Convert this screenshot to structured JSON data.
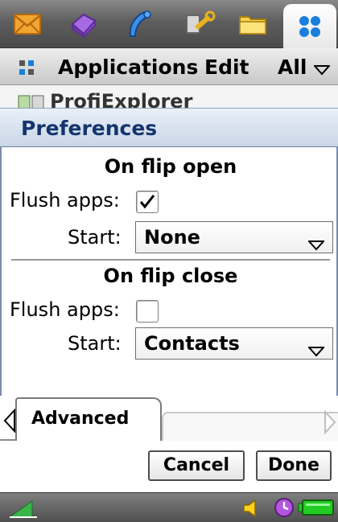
{
  "topbar": {
    "icons": [
      "messaging-icon",
      "web-icon",
      "phone-icon",
      "tools-icon",
      "folder-icon",
      "applications-grid-icon"
    ]
  },
  "menubar": {
    "title": "Applications",
    "edit": "Edit",
    "filter": "All"
  },
  "background_item": "ProfiExplorer",
  "dialog": {
    "title": "Preferences",
    "on_open": {
      "heading": "On flip open",
      "flush_label": "Flush apps:",
      "flush_checked": true,
      "start_label": "Start:",
      "start_value": "None"
    },
    "on_close": {
      "heading": "On flip close",
      "flush_label": "Flush apps:",
      "flush_checked": false,
      "start_label": "Start:",
      "start_value": "Contacts"
    },
    "tabs": [
      "Advanced"
    ],
    "buttons": {
      "cancel": "Cancel",
      "done": "Done"
    }
  },
  "status": {
    "icons": [
      "signal-icon",
      "volume-icon",
      "alarm-icon",
      "battery-icon"
    ]
  },
  "colors": {
    "title_text": "#14356f",
    "battery": "#22cc22"
  }
}
